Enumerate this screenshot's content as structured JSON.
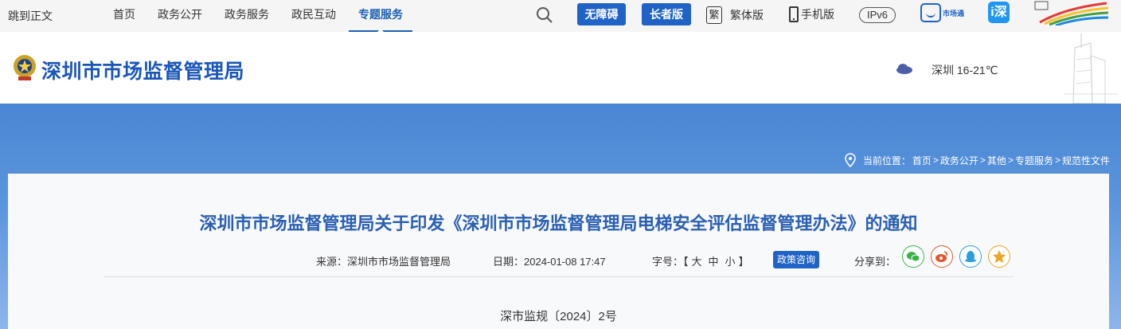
{
  "topbar": {
    "skip_label": "跳到正文",
    "nav": [
      {
        "label": "首页",
        "active": false
      },
      {
        "label": "政务公开",
        "active": false
      },
      {
        "label": "政务服务",
        "active": false
      },
      {
        "label": "政民互动",
        "active": false
      },
      {
        "label": "专题服务",
        "active": true
      }
    ],
    "search_icon": "search-icon",
    "accessible_label": "无障碍",
    "elder_label": "长者版",
    "trad_glyph": "繁",
    "trad_label": "繁体版",
    "mobile_label": "手机版",
    "ipv6_label": "IPv6",
    "shc_label": "市场通",
    "app_glyph": "i深"
  },
  "header": {
    "site_title": "深圳市市场监督管理局",
    "weather": "深圳 16-21℃"
  },
  "breadcrumb": {
    "prefix": "当前位置：",
    "items": [
      "首页",
      "政务公开",
      "其他",
      "专题服务",
      "规范性文件"
    ],
    "separator": ">"
  },
  "article": {
    "title": "深圳市市场监督管理局关于印发《深圳市市场监督管理局电梯安全评估监督管理办法》的通知",
    "source_label": "来源：深圳市市场监督管理局",
    "date_label": "日期：2024-01-08 17:47",
    "font_size_prefix": "字号：【",
    "font_size_options": [
      "大",
      "中",
      "小"
    ],
    "font_size_suffix": "】",
    "policy_button": "政策咨询",
    "share_label": "分享到：",
    "doc_number": "深市监规〔2024〕2号"
  },
  "colors": {
    "brand_blue": "#1f63c6",
    "title_blue": "#2a5fb2",
    "banner_top": "#4a86d4",
    "banner_bottom": "#8db6ea"
  }
}
